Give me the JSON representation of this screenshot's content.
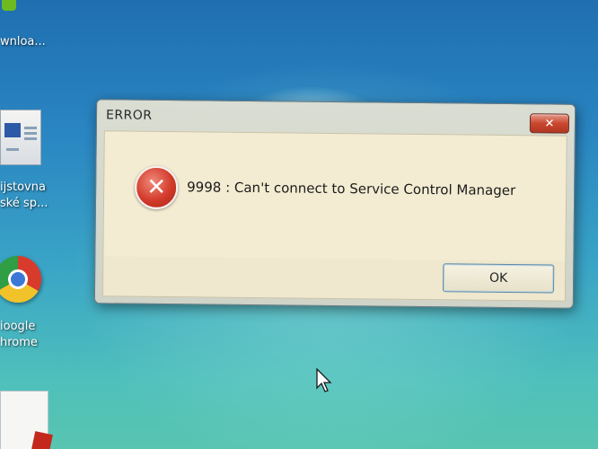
{
  "desktop": {
    "icons": [
      {
        "label": "wnloa..."
      },
      {
        "label_line1": "ijstovna",
        "label_line2": "ské sp..."
      },
      {
        "label_line1": "ioogle",
        "label_line2": "hrome"
      },
      {
        "label": ""
      }
    ]
  },
  "dialog": {
    "title": "ERROR",
    "close_label": "✕",
    "icon": "error-icon",
    "message": "9998 : Can't connect to Service Control Manager",
    "ok_label": "OK"
  },
  "colors": {
    "error_red": "#d23a2a",
    "dialog_bg": "#f3ecd2",
    "desktop_blue": "#2a86c2"
  }
}
